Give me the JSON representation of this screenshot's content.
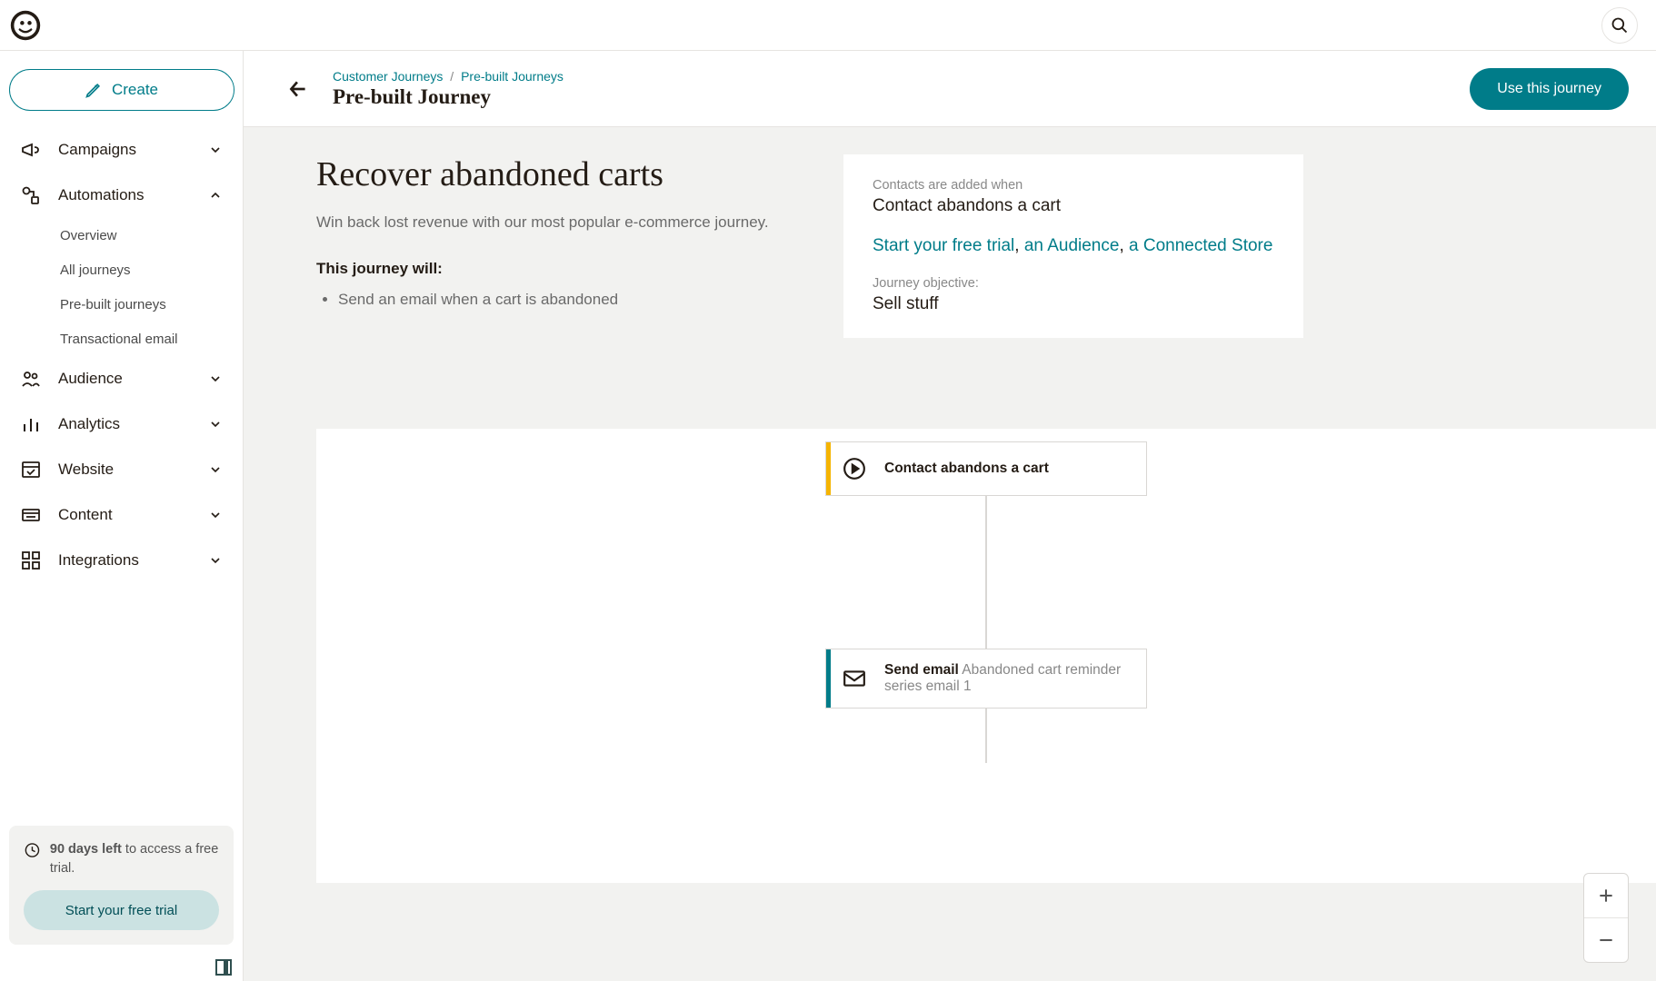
{
  "header": {
    "create_label": "Create"
  },
  "sidebar": {
    "items": [
      {
        "label": "Campaigns",
        "expanded": false
      },
      {
        "label": "Automations",
        "expanded": true,
        "children": [
          {
            "label": "Overview"
          },
          {
            "label": "All journeys"
          },
          {
            "label": "Pre-built journeys"
          },
          {
            "label": "Transactional email"
          }
        ]
      },
      {
        "label": "Audience",
        "expanded": false
      },
      {
        "label": "Analytics",
        "expanded": false
      },
      {
        "label": "Website",
        "expanded": false
      },
      {
        "label": "Content",
        "expanded": false
      },
      {
        "label": "Integrations",
        "expanded": false
      }
    ],
    "trial": {
      "days_bold": "90 days left",
      "days_rest": " to access a free trial.",
      "cta": "Start your free trial"
    }
  },
  "page": {
    "breadcrumbs": [
      {
        "label": "Customer Journeys"
      },
      {
        "label": "Pre-built Journeys"
      }
    ],
    "title": "Pre-built Journey",
    "use_button": "Use this journey"
  },
  "journey": {
    "title": "Recover abandoned carts",
    "description": "Win back lost revenue with our most popular e-commerce journey.",
    "will_heading": "This journey will:",
    "will_items": [
      "Send an email when a cart is abandoned"
    ],
    "panel": {
      "contacts_label": "Contacts are added when",
      "contacts_value": "Contact abandons a cart",
      "links": [
        {
          "text": "Start your free trial"
        },
        {
          "text": "an Audience"
        },
        {
          "text": "a Connected Store"
        }
      ],
      "link_sep": ", ",
      "objective_label": "Journey objective:",
      "objective_value": "Sell stuff"
    }
  },
  "canvas": {
    "nodes": [
      {
        "type": "trigger",
        "accent": "#f5b400",
        "icon": "play-circle-icon",
        "title": "Contact abandons a cart"
      },
      {
        "type": "action",
        "accent": "#007c89",
        "icon": "mail-icon",
        "title": "Send email",
        "subtitle": "Abandoned cart reminder series email 1"
      }
    ]
  }
}
